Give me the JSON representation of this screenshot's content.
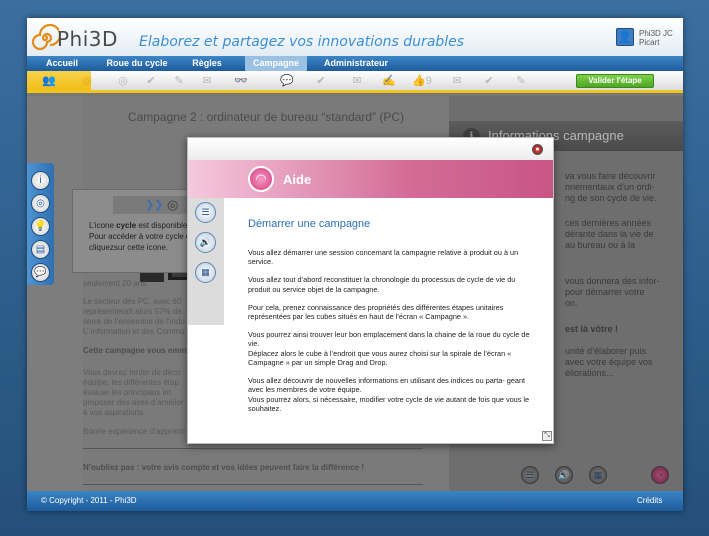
{
  "app": {
    "logo_text": "Phi3D",
    "tagline": "Elaborez et partagez vos innovations durables",
    "user_name": "Phi3D JC Picart"
  },
  "nav": {
    "items": [
      {
        "label": "Accueil"
      },
      {
        "label": "Roue du cycle"
      },
      {
        "label": "Règles"
      },
      {
        "label": "Campagne"
      },
      {
        "label": "Administrateur"
      }
    ],
    "active": "Campagne"
  },
  "stepbar": {
    "badge_count": "9",
    "validate_label": "Valider l'étape"
  },
  "campaign": {
    "title": "Campagne 2 : ordinateur de bureau “standard” (PC)",
    "lines": [
      "seulement 20 ans.",
      "Le secteur des PC, avec 60",
      "représenteraît alors 57% de",
      "serre de l’ensemble de l’indu",
      "L’ information et des Commu",
      "Vous devrez tenter de déco",
      "équipe, les différentes étap",
      "évaluer les principaux im",
      "proposer des axes d’amélior",
      "à vos aspirations.",
      "Bonne expérience d’apprenti"
    ],
    "bold_line": "Cette campagne vous emm",
    "closing": "N’oubliez pas : votre avis compte et vos idées peuvent faire la différence !"
  },
  "tooltip": {
    "line1_prefix": "L’icone ",
    "line1_bold": "cycle",
    "line1_suffix": " est disponible",
    "line2": "Pour accéder à votre cycle de",
    "line3": "cliquezsur cette icone."
  },
  "info": {
    "title": "Informations campagne",
    "lines": [
      "va vous faire découvrir",
      "nnementaux d’un ordi-",
      "ng de son cycle de vie.",
      "ces dernières années",
      "dérante dans la vie de",
      "au bureau ou à la",
      "vous donnera des infor-",
      "pour démarrer votre",
      "on.",
      "unité d’élaborer puis",
      "avec votre équipe vos",
      "éliorations..."
    ],
    "bold_line": "est là vôtre !"
  },
  "modal": {
    "title": "Aide",
    "heading": "Démarrer une campagne",
    "paragraphs": [
      "Vous allez démarrer une session concernant  la campagne relative à  produit ou à un service.",
      "Vous allez  tout d’abord reconstituer  la chronologie du processus de  cycle de vie du produit ou service objet de la campagne.",
      "Pour cela, prenez connaissance des propriétés des différentes étapes unitaires représentées par les cubes situés en haut de l’écran « Campagne ».",
      "Vous pourrez ainsi trouver leur bon emplacement dans la chaine de la roue du cycle de vie.\nDéplacez alors le cube à l’endroit que vous aurez choisi sur la spirale de l’écran « Campagne » par un simple Drag and Drop.",
      "Vous allez découvrir de nouvelles informations en utilisant des indices ou parta- geant avec les membres de votre équipe.\nVous pourrez alors, si nécessaire, modifier votre cycle de vie autant de fois que vous le souhaitez."
    ]
  },
  "footer": {
    "copyright": "© Copyright - 2011 - Phi3D",
    "credits": "Crédits"
  },
  "colors": {
    "nav_blue": "#1f5b9c",
    "tagline_blue": "#3b8fd2",
    "aide_pink": "#d46c97",
    "validate_green": "#4ea624",
    "step_yellow": "#f2c51a"
  }
}
